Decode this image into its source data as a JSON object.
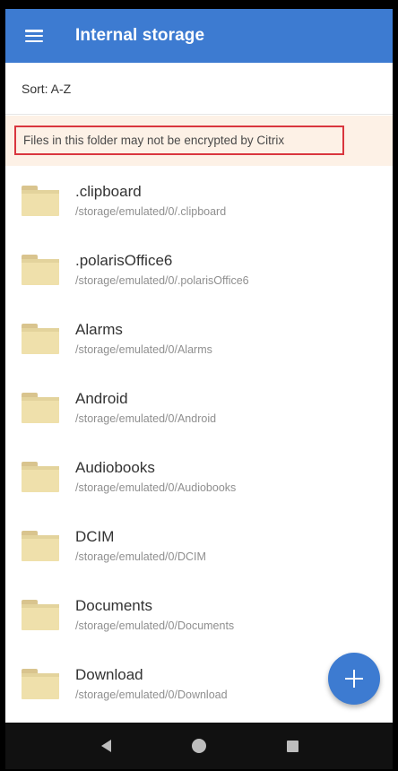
{
  "appbar": {
    "title": "Internal storage",
    "menu_icon": "hamburger-menu-icon",
    "color": "#3d7bd1"
  },
  "sort": {
    "label": "Sort: A-Z"
  },
  "warning": {
    "text": "Files in this folder may not be encrypted by Citrix"
  },
  "files": [
    {
      "name": ".clipboard",
      "path": "/storage/emulated/0/.clipboard"
    },
    {
      "name": ".polarisOffice6",
      "path": "/storage/emulated/0/.polarisOffice6"
    },
    {
      "name": "Alarms",
      "path": "/storage/emulated/0/Alarms"
    },
    {
      "name": "Android",
      "path": "/storage/emulated/0/Android"
    },
    {
      "name": "Audiobooks",
      "path": "/storage/emulated/0/Audiobooks"
    },
    {
      "name": "DCIM",
      "path": "/storage/emulated/0/DCIM"
    },
    {
      "name": "Documents",
      "path": "/storage/emulated/0/Documents"
    },
    {
      "name": "Download",
      "path": "/storage/emulated/0/Download"
    }
  ],
  "fab": {
    "icon": "plus-icon"
  },
  "navbar": {
    "icons": [
      "back-icon",
      "home-icon",
      "recents-icon"
    ]
  }
}
